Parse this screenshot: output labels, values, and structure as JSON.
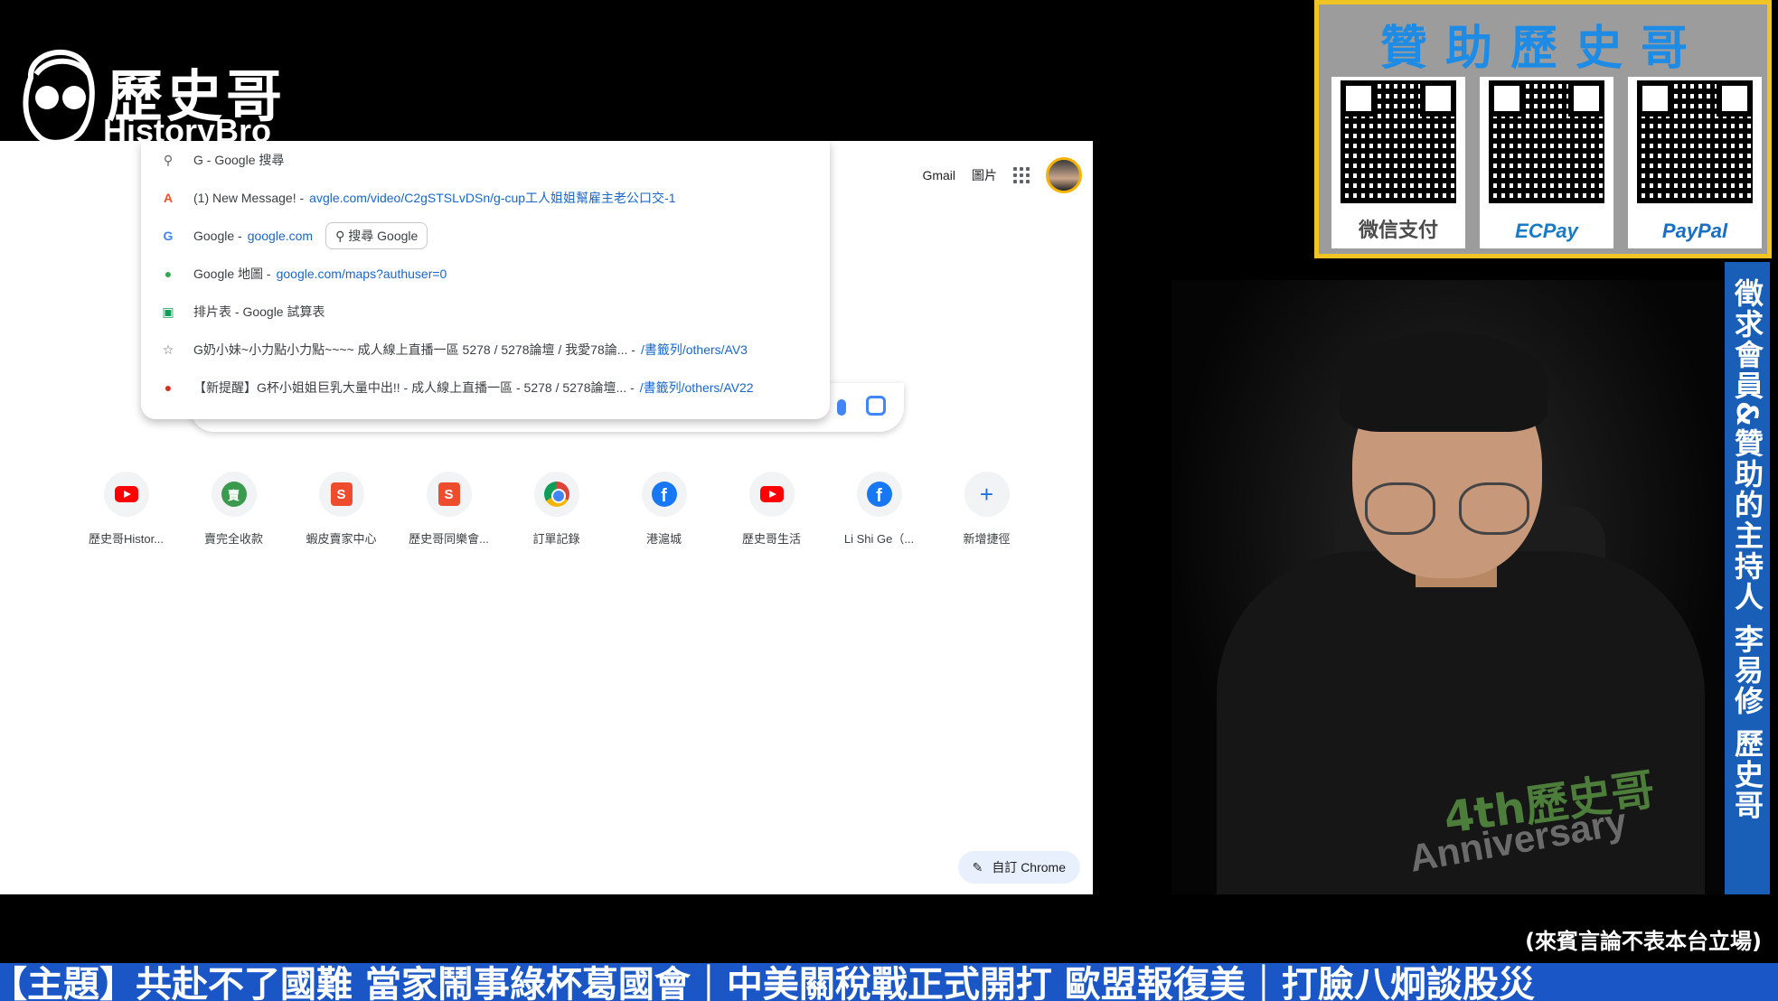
{
  "logo": {
    "name_cn": "歷史哥",
    "name_en": "HistoryBro"
  },
  "browser": {
    "top_links": {
      "gmail": "Gmail",
      "images": "圖片"
    },
    "suggestions": [
      {
        "icon": "search-icon",
        "text": "G - Google 搜尋",
        "url": ""
      },
      {
        "icon": "site-favicon-icon",
        "text": "(1) New Message! - ",
        "url": "avgle.com/video/C2gSTSLvDSn/g-cup工人姐姐幫雇主老公口交-1"
      },
      {
        "icon": "google-icon",
        "text": "Google - ",
        "url": "google.com",
        "chip": "搜尋 Google"
      },
      {
        "icon": "map-pin-icon",
        "text": "Google 地圖 - ",
        "url": "google.com/maps?authuser=0"
      },
      {
        "icon": "sheets-icon",
        "text": "排片表 - Google 試算表",
        "url": ""
      },
      {
        "icon": "star-icon",
        "text": "G奶小妹~小力點小力點~~~~ 成人線上直播一區 5278 / 5278論壇 / 我愛78論... - ",
        "url": "/書籤列/others/AV3"
      },
      {
        "icon": "bookmark-icon",
        "text": "【新提醒】G杯小姐姐巨乳大量中出!! - 成人線上直播一區 - 5278 / 5278論壇... - ",
        "url": "/書籤列/others/AV22"
      }
    ],
    "shortcuts": [
      {
        "icon": "youtube-icon",
        "label": "歷史哥Histor..."
      },
      {
        "icon": "green-circle-icon",
        "label": "賣完全收款"
      },
      {
        "icon": "shopee-icon",
        "label": "蝦皮賣家中心"
      },
      {
        "icon": "shopee-icon",
        "label": "歷史哥同樂會..."
      },
      {
        "icon": "chrome-icon",
        "label": "訂單記錄"
      },
      {
        "icon": "facebook-icon",
        "label": "港滬城"
      },
      {
        "icon": "youtube-icon",
        "label": "歷史哥生活"
      },
      {
        "icon": "facebook-icon",
        "label": "Li Shi Ge（..."
      },
      {
        "icon": "plus-icon",
        "label": "新增捷徑"
      }
    ],
    "customize_label": "自訂 Chrome"
  },
  "sponsor": {
    "title": "贊助歷史哥",
    "payments": [
      {
        "label": "微信支付",
        "color": "#4b4b4b"
      },
      {
        "label": "ECPay",
        "color": "#1b7ac4"
      },
      {
        "label": "PayPal",
        "color": "#1a6fc4"
      }
    ]
  },
  "webcam": {
    "shirt_text": "4th歷史哥",
    "shirt_sub": "Anniversary"
  },
  "vertical_banner": "徵求會員&贊助的主持人 李易修 歷史哥",
  "disclaimer": "(來賓言論不表本台立場)",
  "ticker": "【主題】共赴不了國難 當家鬧事綠杯葛國會｜中美關稅戰正式開打 歐盟報復美｜打臉八炯談股災"
}
